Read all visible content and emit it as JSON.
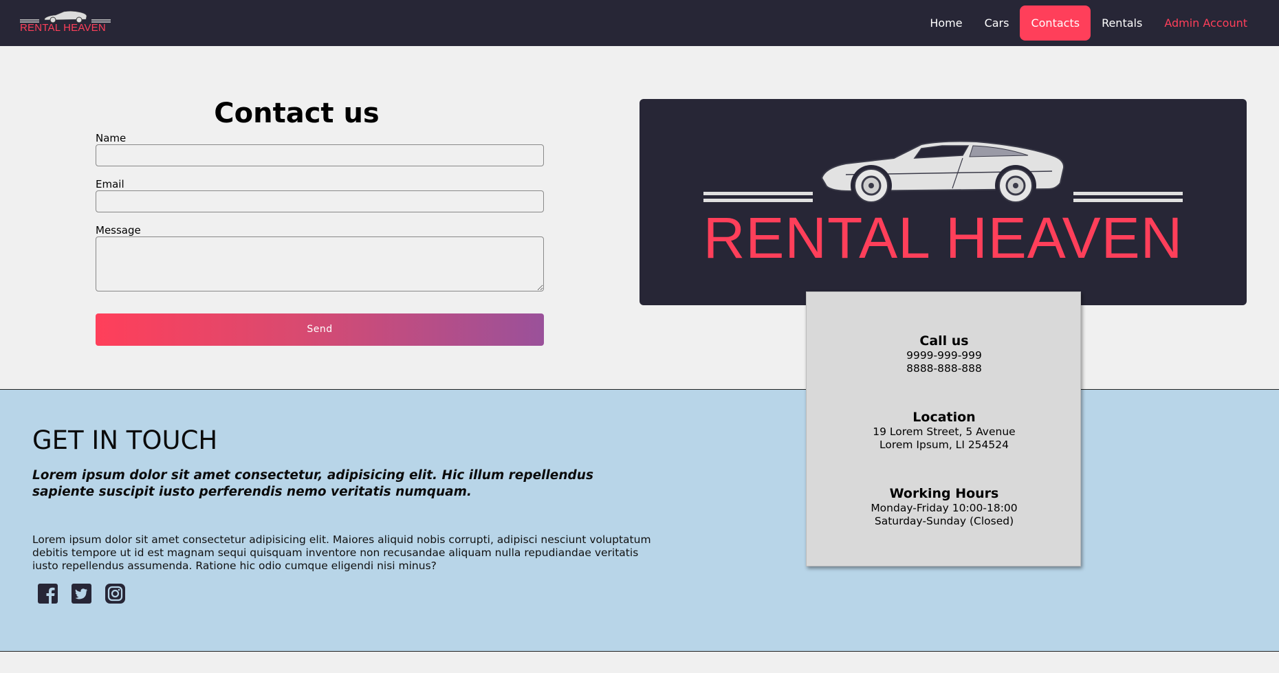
{
  "brand": {
    "name": "RENTAL HEAVEN"
  },
  "nav": {
    "items": [
      {
        "label": "Home"
      },
      {
        "label": "Cars"
      },
      {
        "label": "Contacts",
        "active": true
      },
      {
        "label": "Rentals"
      },
      {
        "label": "Admin Account"
      }
    ]
  },
  "form": {
    "title": "Contact us",
    "name_label": "Name",
    "name_value": "",
    "email_label": "Email",
    "email_value": "",
    "message_label": "Message",
    "message_value": "",
    "send_label": "Send"
  },
  "info": {
    "call": {
      "heading": "Call us",
      "lines": [
        "9999-999-999",
        "8888-888-888"
      ]
    },
    "location": {
      "heading": "Location",
      "lines": [
        "19 Lorem Street, 5 Avenue",
        "Lorem Ipsum, LI 254524"
      ]
    },
    "hours": {
      "heading": "Working Hours",
      "lines": [
        "Monday-Friday 10:00-18:00",
        "Saturday-Sunday (Closed)"
      ]
    }
  },
  "footer": {
    "title": "GET IN TOUCH",
    "lead": "Lorem ipsum dolor sit amet consectetur, adipisicing elit. Hic illum repellendus sapiente suscipit iusto perferendis nemo veritatis numquam.",
    "body": "Lorem ipsum dolor sit amet consectetur adipisicing elit. Maiores aliquid nobis corrupti, adipisci nesciunt voluptatum debitis tempore ut id est magnam sequi quisquam inventore non recusandae aliquam nulla repudiandae veritatis iusto repellendus assumenda. Ratione hic odio cumque eligendi nisi minus?",
    "social": [
      "facebook-icon",
      "twitter-icon",
      "instagram-icon"
    ]
  },
  "colors": {
    "navbar_bg": "#272636",
    "accent": "#ff3f5a",
    "gradient_end": "#9a519a",
    "footer_bg": "#b8d5e8",
    "card_bg": "#d9d9d9",
    "page_bg": "#f0f0f0"
  }
}
